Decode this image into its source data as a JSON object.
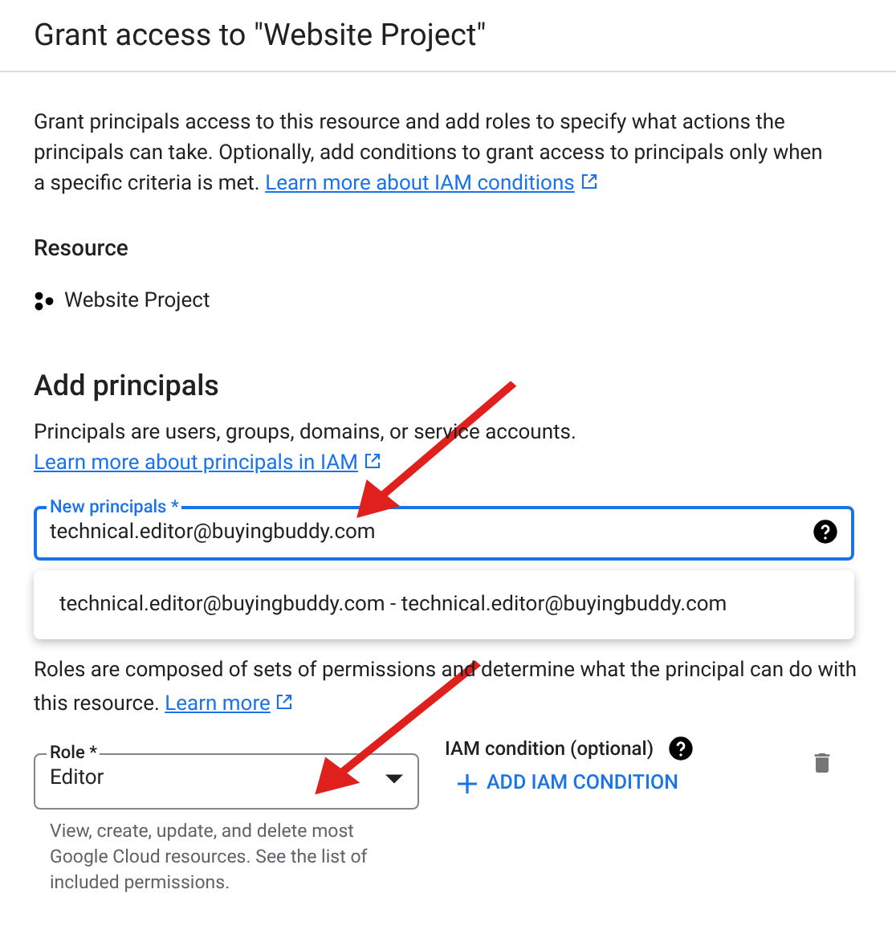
{
  "window": {
    "title": "Grant access to \"Website Project\""
  },
  "intro": {
    "text": "Grant principals access to this resource and add roles to specify what actions the principals can take. Optionally, add conditions to grant access to principals only when a specific criteria is met.",
    "link": "Learn more about IAM conditions"
  },
  "resource": {
    "heading": "Resource",
    "name": "Website Project"
  },
  "add_principals": {
    "heading": "Add principals",
    "text": "Principals are users, groups, domains, or service accounts.",
    "link": "Learn more about principals in IAM",
    "field": {
      "label": "New principals *",
      "value": "technical.editor@buyingbuddy.com"
    },
    "suggestions": [
      "technical.editor@buyingbuddy.com - technical.editor@buyingbuddy.com"
    ]
  },
  "roles": {
    "text": "Roles are composed of sets of permissions and determine what the principal can do with this resource.",
    "link": "Learn more",
    "role_field": {
      "label": "Role *",
      "value": "Editor",
      "helper": "View, create, update, and delete most Google Cloud resources. See the list of included permissions."
    },
    "condition": {
      "label": "IAM condition (optional)",
      "button": "ADD IAM CONDITION"
    }
  }
}
